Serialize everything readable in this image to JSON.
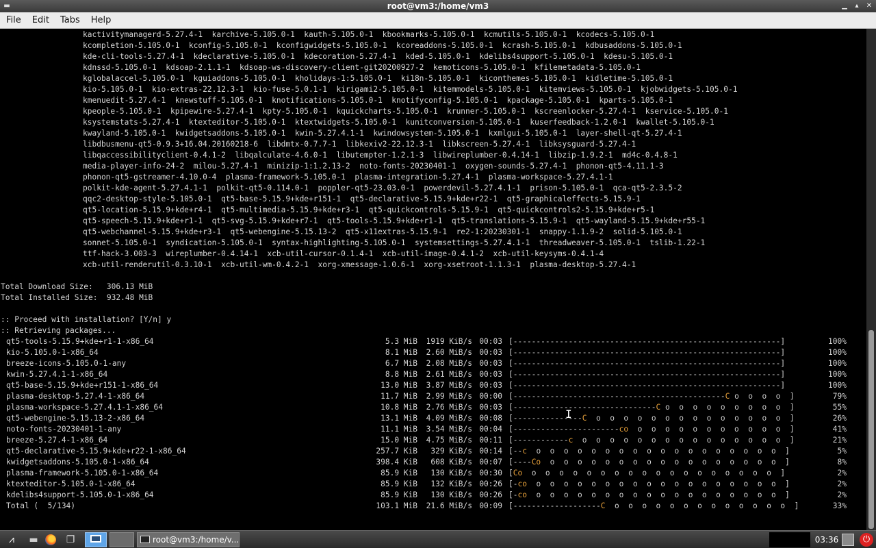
{
  "window": {
    "title": "root@vm3:/home/vm3",
    "menu_icon": "window-menu-icon",
    "buttons": [
      "minimize-icon",
      "maximize-icon",
      "close-icon"
    ]
  },
  "menubar": {
    "items": [
      "File",
      "Edit",
      "Tabs",
      "Help"
    ]
  },
  "terminal": {
    "package_lines": [
      "kactivitymanagerd-5.27.4-1  karchive-5.105.0-1  kauth-5.105.0-1  kbookmarks-5.105.0-1  kcmutils-5.105.0-1  kcodecs-5.105.0-1",
      "kcompletion-5.105.0-1  kconfig-5.105.0-1  kconfigwidgets-5.105.0-1  kcoreaddons-5.105.0-1  kcrash-5.105.0-1  kdbusaddons-5.105.0-1",
      "kde-cli-tools-5.27.4-1  kdeclarative-5.105.0-1  kdecoration-5.27.4-1  kded-5.105.0-1  kdelibs4support-5.105.0-1  kdesu-5.105.0-1",
      "kdnssd-5.105.0-1  kdsoap-2.1.1-1  kdsoap-ws-discovery-client-git20200927-2  kemoticons-5.105.0-1  kfilemetadata-5.105.0-1",
      "kglobalaccel-5.105.0-1  kguiaddons-5.105.0-1  kholidays-1:5.105.0-1  ki18n-5.105.0-1  kiconthemes-5.105.0-1  kidletime-5.105.0-1",
      "kio-5.105.0-1  kio-extras-22.12.3-1  kio-fuse-5.0.1-1  kirigami2-5.105.0-1  kitemmodels-5.105.0-1  kitemviews-5.105.0-1  kjobwidgets-5.105.0-1",
      "kmenuedit-5.27.4-1  knewstuff-5.105.0-1  knotifications-5.105.0-1  knotifyconfig-5.105.0-1  kpackage-5.105.0-1  kparts-5.105.0-1",
      "kpeople-5.105.0-1  kpipewire-5.27.4-1  kpty-5.105.0-1  kquickcharts-5.105.0-1  krunner-5.105.0-1  kscreenlocker-5.27.4-1  kservice-5.105.0-1",
      "ksystemstats-5.27.4-1  ktexteditor-5.105.0-1  ktextwidgets-5.105.0-1  kunitconversion-5.105.0-1  kuserfeedback-1.2.0-1  kwallet-5.105.0-1",
      "kwayland-5.105.0-1  kwidgetsaddons-5.105.0-1  kwin-5.27.4.1-1  kwindowsystem-5.105.0-1  kxmlgui-5.105.0-1  layer-shell-qt-5.27.4-1",
      "libdbusmenu-qt5-0.9.3+16.04.20160218-6  libdmtx-0.7.7-1  libkexiv2-22.12.3-1  libkscreen-5.27.4-1  libksysguard-5.27.4-1",
      "libqaccessibilityclient-0.4.1-2  libqalculate-4.6.0-1  libutempter-1.2.1-3  libwireplumber-0.4.14-1  libzip-1.9.2-1  md4c-0.4.8-1",
      "media-player-info-24-2  milou-5.27.4-1  minizip-1:1.2.13-2  noto-fonts-20230401-1  oxygen-sounds-5.27.4-1  phonon-qt5-4.11.1-3",
      "phonon-qt5-gstreamer-4.10.0-4  plasma-framework-5.105.0-1  plasma-integration-5.27.4-1  plasma-workspace-5.27.4.1-1",
      "polkit-kde-agent-5.27.4.1-1  polkit-qt5-0.114.0-1  poppler-qt5-23.03.0-1  powerdevil-5.27.4.1-1  prison-5.105.0-1  qca-qt5-2.3.5-2",
      "qqc2-desktop-style-5.105.0-1  qt5-base-5.15.9+kde+r151-1  qt5-declarative-5.15.9+kde+r22-1  qt5-graphicaleffects-5.15.9-1",
      "qt5-location-5.15.9+kde+r4-1  qt5-multimedia-5.15.9+kde+r3-1  qt5-quickcontrols-5.15.9-1  qt5-quickcontrols2-5.15.9+kde+r5-1",
      "qt5-speech-5.15.9+kde+r1-1  qt5-svg-5.15.9+kde+r7-1  qt5-tools-5.15.9+kde+r1-1  qt5-translations-5.15.9-1  qt5-wayland-5.15.9+kde+r55-1",
      "qt5-webchannel-5.15.9+kde+r3-1  qt5-webengine-5.15.13-2  qt5-x11extras-5.15.9-1  re2-1:20230301-1  snappy-1.1.9-2  solid-5.105.0-1",
      "sonnet-5.105.0-1  syndication-5.105.0-1  syntax-highlighting-5.105.0-1  systemsettings-5.27.4.1-1  threadweaver-5.105.0-1  tslib-1.22-1",
      "ttf-hack-3.003-3  wireplumber-0.4.14-1  xcb-util-cursor-0.1.4-1  xcb-util-image-0.4.1-2  xcb-util-keysyms-0.4.1-4",
      "xcb-util-renderutil-0.3.10-1  xcb-util-wm-0.4.2-1  xorg-xmessage-1.0.6-1  xorg-xsetroot-1.1.3-1  plasma-desktop-5.27.4-1"
    ],
    "total_download": "Total Download Size:   306.13 MiB",
    "total_installed": "Total Installed Size:  932.48 MiB",
    "proceed_prompt": ":: Proceed with installation? [Y/n] y",
    "retrieving": ":: Retrieving packages...",
    "downloads": [
      {
        "name": "qt5-tools-5.15.9+kde+r1-1-x86_64",
        "size": "5.3 MiB",
        "speed": "1919 KiB/s",
        "time": "00:03",
        "bar": "[----------------------------------------------------------]",
        "pct": "100%",
        "progress": 1.0
      },
      {
        "name": "kio-5.105.0-1-x86_64",
        "size": "8.1 MiB",
        "speed": "2.60 MiB/s",
        "time": "00:03",
        "bar": "[----------------------------------------------------------]",
        "pct": "100%",
        "progress": 1.0
      },
      {
        "name": "breeze-icons-5.105.0-1-any",
        "size": "6.7 MiB",
        "speed": "2.08 MiB/s",
        "time": "00:03",
        "bar": "[----------------------------------------------------------]",
        "pct": "100%",
        "progress": 1.0
      },
      {
        "name": "kwin-5.27.4.1-1-x86_64",
        "size": "8.8 MiB",
        "speed": "2.61 MiB/s",
        "time": "00:03",
        "bar": "[----------------------------------------------------------]",
        "pct": "100%",
        "progress": 1.0
      },
      {
        "name": "qt5-base-5.15.9+kde+r151-1-x86_64",
        "size": "13.0 MiB",
        "speed": "3.87 MiB/s",
        "time": "00:03",
        "bar": "[----------------------------------------------------------]",
        "pct": "100%",
        "progress": 1.0
      },
      {
        "name": "plasma-desktop-5.27.4-1-x86_64",
        "size": "11.7 MiB",
        "speed": "2.99 MiB/s",
        "time": "00:00",
        "bar_done": "[----------------------------------------------",
        "bar_pac": "C",
        "bar_rest": " o  o  o  o  ]",
        "pct": "79%",
        "progress": 0.79
      },
      {
        "name": "plasma-workspace-5.27.4.1-1-x86_64",
        "size": "10.8 MiB",
        "speed": "2.76 MiB/s",
        "time": "00:03",
        "bar_done": "[-------------------------------",
        "bar_pac": "C",
        "bar_rest": " o  o  o  o  o  o  o  o  o  ]",
        "pct": "55%",
        "progress": 0.55
      },
      {
        "name": "qt5-webengine-5.15.13-2-x86_64",
        "size": "13.1 MiB",
        "speed": "4.09 MiB/s",
        "time": "00:08",
        "bar_done": "[---------------",
        "bar_pac": "C",
        "bar_rest": "  o  o  o  o  o  o  o  o  o  o  o  o  o  o  ]",
        "pct": "26%",
        "progress": 0.26
      },
      {
        "name": "noto-fonts-20230401-1-any",
        "size": "11.1 MiB",
        "speed": "3.54 MiB/s",
        "time": "00:04",
        "bar_done": "[-----------------------",
        "bar_pac": "co",
        "bar_rest": "  o  o  o  o  o  o  o  o  o  o  o  ]",
        "pct": "41%",
        "progress": 0.41
      },
      {
        "name": "breeze-5.27.4-1-x86_64",
        "size": "15.0 MiB",
        "speed": "4.75 MiB/s",
        "time": "00:11",
        "bar_done": "[------------",
        "bar_pac": "c",
        "bar_rest": "  o  o  o  o  o  o  o  o  o  o  o  o  o  o  o  ]",
        "pct": "21%",
        "progress": 0.21
      },
      {
        "name": "qt5-declarative-5.15.9+kde+r22-1-x86_64",
        "size": "257.7 KiB",
        "speed": "329 KiB/s",
        "time": "00:14",
        "bar_done": "[--",
        "bar_pac": "c",
        "bar_rest": "  o  o  o  o  o  o  o  o  o  o  o  o  o  o  o  o  o  o  ]",
        "pct": "5%",
        "progress": 0.05
      },
      {
        "name": "kwidgetsaddons-5.105.0-1-x86_64",
        "size": "398.4 KiB",
        "speed": "608 KiB/s",
        "time": "00:07",
        "bar_done": "[----",
        "bar_pac": "Co",
        "bar_rest": "  o  o  o  o  o  o  o  o  o  o  o  o  o  o  o  o  o  ]",
        "pct": "8%",
        "progress": 0.08
      },
      {
        "name": "plasma-framework-5.105.0-1-x86_64",
        "size": "85.9 KiB",
        "speed": "130 KiB/s",
        "time": "00:30",
        "bar_done": "[",
        "bar_pac": "Co",
        "bar_rest": "  o  o  o  o  o  o  o  o  o  o  o  o  o  o  o  o  o  o  ]",
        "pct": "2%",
        "progress": 0.02
      },
      {
        "name": "ktexteditor-5.105.0-1-x86_64",
        "size": "85.9 KiB",
        "speed": "132 KiB/s",
        "time": "00:26",
        "bar_done": "[-",
        "bar_pac": "co",
        "bar_rest": "  o  o  o  o  o  o  o  o  o  o  o  o  o  o  o  o  o  o  ]",
        "pct": "2%",
        "progress": 0.02
      },
      {
        "name": "kdelibs4support-5.105.0-1-x86_64",
        "size": "85.9 KiB",
        "speed": "130 KiB/s",
        "time": "00:26",
        "bar_done": "[-",
        "bar_pac": "co",
        "bar_rest": "  o  o  o  o  o  o  o  o  o  o  o  o  o  o  o  o  o  o  ]",
        "pct": "2%",
        "progress": 0.02
      },
      {
        "name": "Total (  5/134)",
        "size": "103.1 MiB",
        "speed": "21.6 MiB/s",
        "time": "00:09",
        "bar_done": "[-------------------",
        "bar_pac": "C",
        "bar_rest": "  o  o  o  o  o  o  o  o  o  o  o  o  o  ]",
        "pct": "33%",
        "progress": 0.33
      }
    ]
  },
  "taskbar": {
    "start_icon": "start-menu-icon",
    "files_icon": "file-manager-icon",
    "firefox_icon": "firefox-icon",
    "windows_icon": "window-list-icon",
    "desktop_icon": "show-desktop-icon",
    "task_label": "root@vm3:/home/v...",
    "clock": "03:36",
    "colors": {
      "pacman": "#e8a13a",
      "power": "#d22222"
    }
  }
}
